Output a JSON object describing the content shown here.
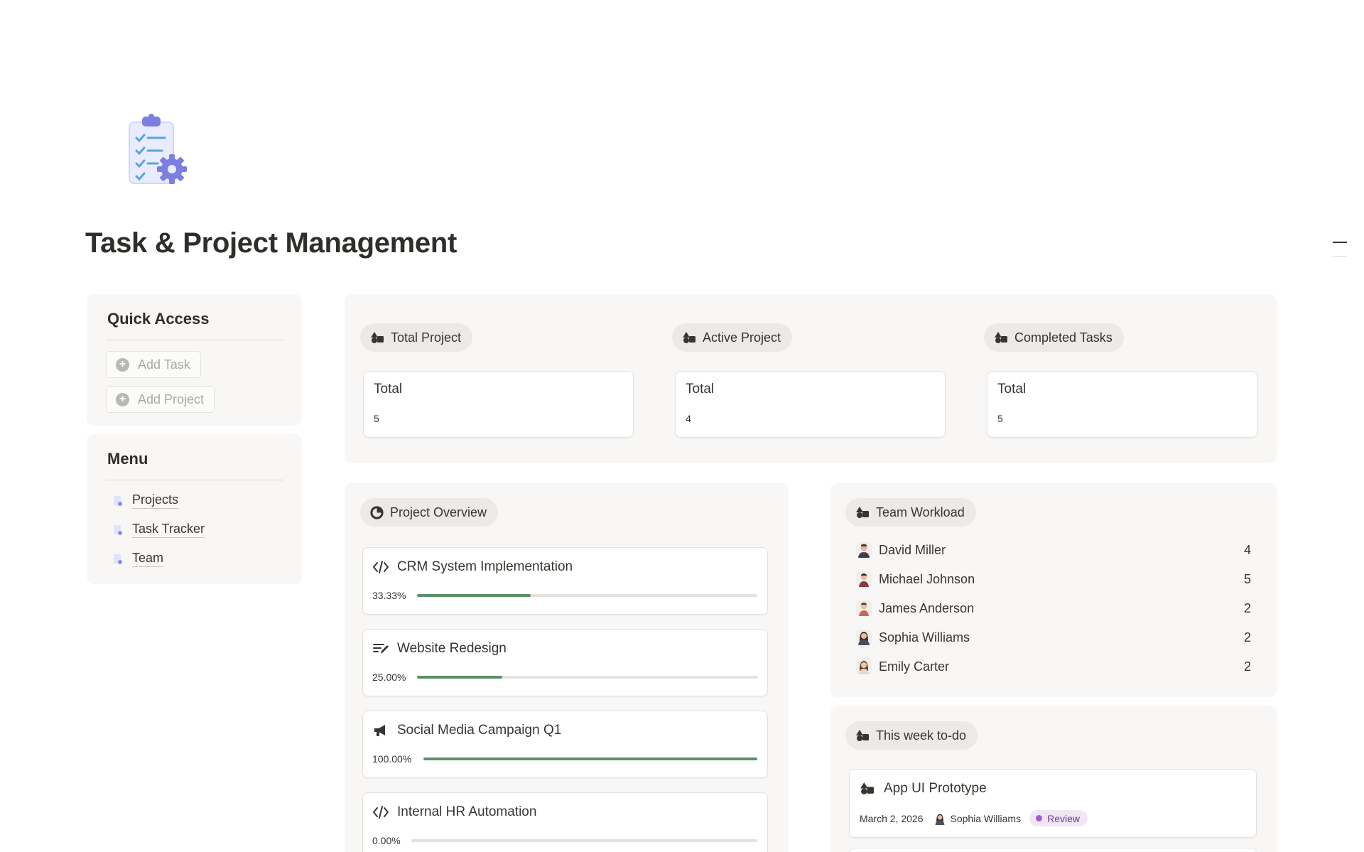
{
  "page": {
    "title": "Task & Project Management",
    "icon": "clipboard-gear-icon"
  },
  "quick_access": {
    "heading": "Quick Access",
    "buttons": [
      {
        "label": "Add Task",
        "icon": "plus-circle-icon"
      },
      {
        "label": "Add Project",
        "icon": "plus-circle-icon"
      }
    ]
  },
  "menu": {
    "heading": "Menu",
    "items": [
      {
        "label": "Projects",
        "icon": "document-icon"
      },
      {
        "label": "Task Tracker",
        "icon": "document-icon"
      },
      {
        "label": "Team",
        "icon": "document-icon"
      }
    ]
  },
  "stats": [
    {
      "pill": "Total Project",
      "label": "Total",
      "value": "5",
      "icon": "shapes-icon"
    },
    {
      "pill": "Active Project",
      "label": "Total",
      "value": "4",
      "icon": "shapes-icon"
    },
    {
      "pill": "Completed Tasks",
      "label": "Total",
      "value": "5",
      "icon": "shapes-icon"
    }
  ],
  "overview": {
    "pill": "Project Overview",
    "icon": "pie-chart-icon",
    "projects": [
      {
        "name": "CRM System Implementation",
        "percent_label": "33.33%",
        "progress": 0.3333,
        "icon": "code-icon"
      },
      {
        "name": "Website Redesign",
        "percent_label": "25.00%",
        "progress": 0.25,
        "icon": "edit-lines-icon"
      },
      {
        "name": "Social Media Campaign Q1",
        "percent_label": "100.00%",
        "progress": 1.0,
        "icon": "megaphone-icon"
      },
      {
        "name": "Internal HR Automation",
        "percent_label": "0.00%",
        "progress": 0.0,
        "icon": "code-icon"
      }
    ]
  },
  "workload": {
    "pill": "Team Workload",
    "icon": "shapes-icon",
    "members": [
      {
        "name": "David Miller",
        "count": "4",
        "avatar": "avatar-man-suit-icon"
      },
      {
        "name": "Michael Johnson",
        "count": "5",
        "avatar": "avatar-man-icon"
      },
      {
        "name": "James Anderson",
        "count": "2",
        "avatar": "avatar-man-icon"
      },
      {
        "name": "Sophia Williams",
        "count": "2",
        "avatar": "avatar-woman-icon"
      },
      {
        "name": "Emily Carter",
        "count": "2",
        "avatar": "avatar-woman-icon"
      }
    ]
  },
  "week": {
    "pill": "This week to-do",
    "icon": "shapes-icon",
    "tasks": [
      {
        "title": "App UI Prototype",
        "date": "March 2, 2026",
        "assignee": "Sophia Williams",
        "status": "Review",
        "icon": "shapes-icon"
      }
    ]
  },
  "colors": {
    "progress_fill": "#5b8f69",
    "progress_track": "#e3e2de",
    "panel_bg": "#f8f7f5",
    "status_review_bg": "#efe6f6",
    "status_review_dot": "#a35bd1"
  }
}
